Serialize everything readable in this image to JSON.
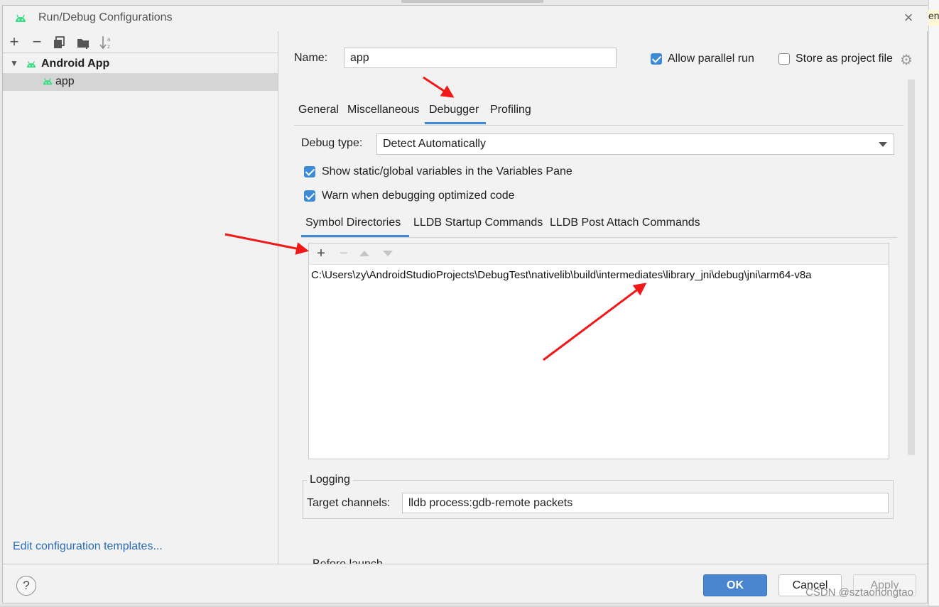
{
  "background": {
    "right_tab_text": "en"
  },
  "dialog": {
    "title": "Run/Debug Configurations",
    "close_glyph": "×"
  },
  "left_toolbar": {
    "add": "+",
    "remove": "−",
    "copy_icon": "copy-icon",
    "folder_icon": "folder-add-icon",
    "sort_icon": "sort-icon"
  },
  "tree": {
    "group_label": "Android App",
    "item_label": "app"
  },
  "edit_templates_link": "Edit configuration templates...",
  "name": {
    "label": "Name:",
    "value": "app"
  },
  "options": {
    "allow_parallel_label": "Allow parallel run",
    "allow_parallel_checked": true,
    "store_label": "Store as project file",
    "store_checked": false
  },
  "tabs": [
    "General",
    "Miscellaneous",
    "Debugger",
    "Profiling"
  ],
  "active_tab": "Debugger",
  "debugger": {
    "debug_type_label": "Debug type:",
    "debug_type_value": "Detect Automatically",
    "show_static_label": "Show static/global variables in the Variables Pane",
    "show_static_checked": true,
    "warn_label": "Warn when debugging optimized code",
    "warn_checked": true,
    "inner_tabs": [
      "Symbol Directories",
      "LLDB Startup Commands",
      "LLDB Post Attach Commands"
    ],
    "active_inner_tab": "Symbol Directories",
    "symbol_toolbar": {
      "add": "+",
      "remove": "−"
    },
    "symbol_directories": [
      "C:\\Users\\zy\\AndroidStudioProjects\\DebugTest\\nativelib\\build\\intermediates\\library_jni\\debug\\jni\\arm64-v8a"
    ]
  },
  "logging": {
    "title": "Logging",
    "target_label": "Target channels:",
    "target_value": "lldb process:gdb-remote packets"
  },
  "before_launch_label": "Before launch",
  "buttons": {
    "help": "?",
    "ok": "OK",
    "cancel": "Cancel",
    "apply": "Apply"
  },
  "watermark": "CSDN @sztaohongtao",
  "colors": {
    "accent": "#3d8bd6",
    "ok_button": "#4a86cf",
    "link": "#2a6db5",
    "android_green": "#3ddc84",
    "annotation_red": "#f01818"
  }
}
